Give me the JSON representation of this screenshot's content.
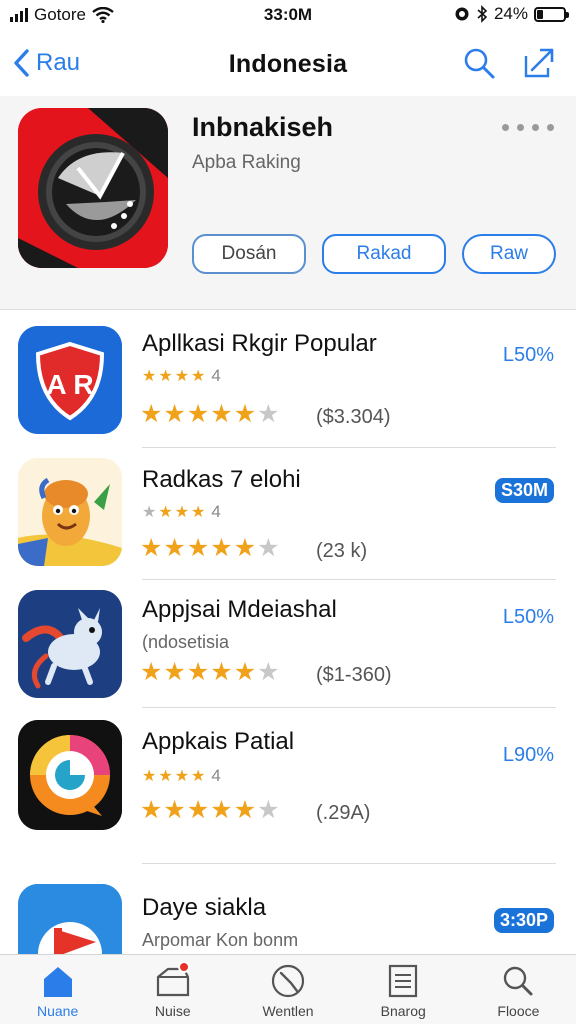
{
  "status_bar": {
    "carrier": "Gotore",
    "time": "33:0M",
    "battery": "24%",
    "battery_level": 0.24
  },
  "navbar": {
    "back_label": "Rau",
    "title": "Indonesia"
  },
  "header": {
    "app_title": "Inbnakiseh",
    "subtitle": "Apba Raking",
    "buttons": [
      "Dosán",
      "Rakad",
      "Raw"
    ]
  },
  "apps": [
    {
      "name": "Apllkasi Rkgir Popular",
      "subtitle": "",
      "small_rating": "4",
      "stars": 4.5,
      "count": "($3.304)",
      "price": "L50%",
      "price_style": "link",
      "icon": "shield-icon",
      "colors": [
        "#1b6ad8",
        "#e12a2a"
      ]
    },
    {
      "name": "Radkas 7 elohi",
      "subtitle": "",
      "small_rating": "4",
      "stars": 4.5,
      "count": "(23 k)",
      "price": "S30M",
      "price_style": "pill",
      "icon": "mascot-icon",
      "colors": [
        "#f2c53a",
        "#3a6cc8"
      ]
    },
    {
      "name": "Appjsai Mdeiashal",
      "subtitle": "(ndosetisia",
      "small_rating": "",
      "stars": 4.5,
      "count": "($1-360)",
      "price": "L50%",
      "price_style": "link",
      "icon": "dragon-icon",
      "colors": [
        "#1d3f82",
        "#e4482e"
      ]
    },
    {
      "name": "Appkais Patial",
      "subtitle": "",
      "small_rating": "4",
      "stars": 4.5,
      "count": "(.29A)",
      "price": "L90%",
      "price_style": "link",
      "icon": "chat-circle-icon",
      "colors": [
        "#111111",
        "#f58a1f"
      ]
    },
    {
      "name": "Daye siakla",
      "subtitle": "Arpomar Kon bonm",
      "small_rating": "",
      "stars": 0,
      "count": "",
      "price": "3:30P",
      "price_style": "pill",
      "icon": "flag-icon",
      "colors": [
        "#2b8be0",
        "#e5332a"
      ]
    }
  ],
  "tabbar": {
    "tabs": [
      {
        "label": "Nuane",
        "icon": "home-icon",
        "active": true
      },
      {
        "label": "Nuise",
        "icon": "inbox-icon",
        "active": false
      },
      {
        "label": "Wentlen",
        "icon": "compass-icon",
        "active": false
      },
      {
        "label": "Bnarog",
        "icon": "list-icon",
        "active": false
      },
      {
        "label": "Flooce",
        "icon": "search-icon",
        "active": false
      }
    ]
  },
  "colors": {
    "accent": "#2b7de9",
    "star": "#f0a21a",
    "hero_icon_red": "#e3141c"
  }
}
